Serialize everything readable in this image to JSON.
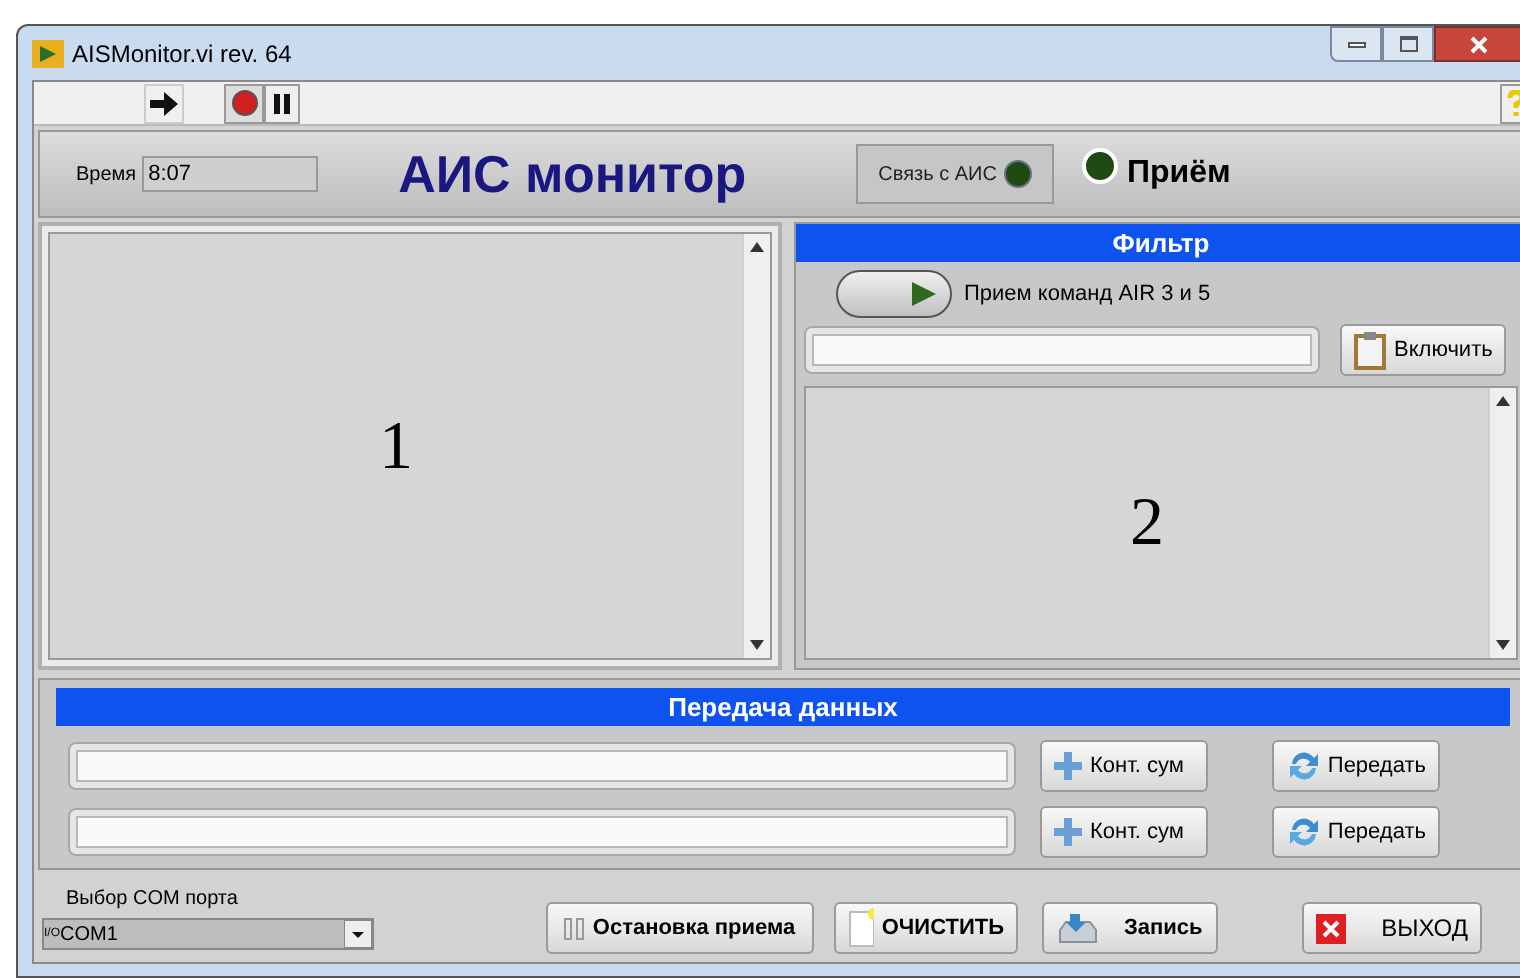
{
  "window": {
    "title": "AISMonitor.vi rev. 64"
  },
  "header": {
    "time_label": "Время",
    "time_value": "8:07",
    "title": "АИС монитор",
    "link_label": "Связь с АИС",
    "link_on": false,
    "receive_label": "Приём",
    "receive_on": false
  },
  "left_panel": {
    "annotation": "1"
  },
  "filter": {
    "title": "Фильтр",
    "toggle_label": "Прием команд AIR 3 и 5",
    "toggle_on": false,
    "enable_button": "Включить",
    "annotation": "2"
  },
  "transfer": {
    "title": "Передача данных",
    "rows": [
      {
        "checksum_button": "Конт. сум",
        "send_button": "Передать"
      },
      {
        "checksum_button": "Конт. сум",
        "send_button": "Передать"
      }
    ]
  },
  "bottom": {
    "port_label": "Выбор COM порта",
    "port_prefix": "I/O",
    "port_value": "COM1",
    "buttons": [
      {
        "kind": "stop",
        "label": "Остановка приема"
      },
      {
        "kind": "clear",
        "label": "ОЧИСТИТЬ"
      },
      {
        "kind": "save",
        "label": "Запись"
      },
      {
        "kind": "exit",
        "label": "ВЫХОД"
      }
    ]
  }
}
